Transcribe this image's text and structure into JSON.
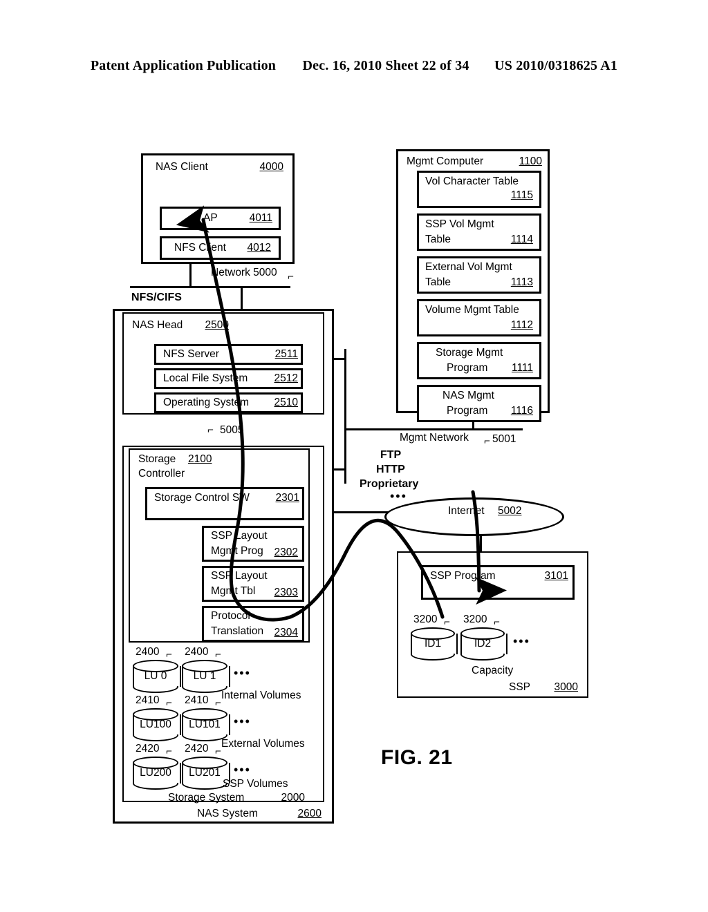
{
  "header": {
    "publication": "Patent Application Publication",
    "date_sheet": "Dec. 16, 2010  Sheet 22 of 34",
    "patent_number": "US 2010/0318625 A1"
  },
  "figure_label": "FIG. 21",
  "diagram": {
    "nas_client": {
      "title": "NAS Client",
      "number": "4000",
      "children": [
        {
          "title": "AP",
          "number": "4011"
        },
        {
          "title": "NFS Client",
          "number": "4012"
        }
      ]
    },
    "mgmt_computer": {
      "title": "Mgmt Computer",
      "number": "1100",
      "children": [
        {
          "line1": "Vol Character Table",
          "line2": "",
          "number": "1115"
        },
        {
          "line1": "SSP Vol Mgmt",
          "line2": "Table",
          "number": "1114"
        },
        {
          "line1": "External Vol Mgmt",
          "line2": "Table",
          "number": "1113"
        },
        {
          "line1": "Volume Mgmt Table",
          "line2": "",
          "number": "1112"
        },
        {
          "line1": "Storage Mgmt",
          "line2": "Program",
          "number": "1111"
        },
        {
          "line1": "NAS Mgmt",
          "line2": "Program",
          "number": "1116"
        }
      ]
    },
    "nas_head": {
      "title": "NAS Head",
      "number": "2500",
      "children": [
        {
          "title": "NFS Server",
          "number": "2511"
        },
        {
          "title": "Local File System",
          "number": "2512"
        },
        {
          "title": "Operating System",
          "number": "2510"
        }
      ]
    },
    "storage_controller": {
      "title_line1": "Storage",
      "title_line2": "Controller",
      "number": "2100",
      "children": [
        {
          "line1": "Storage Control SW",
          "line2": "",
          "number": "2301"
        },
        {
          "line1": "SSP Layout",
          "line2": "Mgmt Prog",
          "number": "2302"
        },
        {
          "line1": "SSP Layout",
          "line2": "Mgmt Tbl",
          "number": "2303"
        },
        {
          "line1": "Protocol",
          "line2": "Translation",
          "number": "2304"
        }
      ]
    },
    "storage_system": {
      "title": "Storage System",
      "number": "2000"
    },
    "nas_system": {
      "title": "NAS System",
      "number": "2600"
    },
    "volumes": {
      "rows": [
        {
          "group_label": "Internal Volumes",
          "ref": "2400",
          "units": [
            "LU 0",
            "LU 1"
          ],
          "ellipsis": "•••"
        },
        {
          "group_label": "External Volumes",
          "ref": "2410",
          "units": [
            "LU100",
            "LU101"
          ],
          "ellipsis": "•••"
        },
        {
          "group_label": "SSP Volumes",
          "ref": "2420",
          "units": [
            "LU200",
            "LU201"
          ],
          "ellipsis": "•••"
        }
      ]
    },
    "ssp": {
      "title": "SSP",
      "number": "3000",
      "program": {
        "title": "SSP Program",
        "number": "3101"
      },
      "capacity_label": "Capacity",
      "disk_ref": "3200",
      "disks": [
        "ID1",
        "ID2"
      ],
      "ellipsis": "•••"
    },
    "networks": {
      "network_5000": {
        "label": "Network 5000",
        "number": "5000"
      },
      "mgmt_network": {
        "label": "Mgmt Network",
        "number": "5001"
      },
      "internet": {
        "label": "Internet",
        "number": "5002"
      },
      "internal_link": {
        "number": "5005"
      }
    },
    "protocol_labels": {
      "nfs_cifs": "NFS/CIFS",
      "stack": [
        "FTP",
        "HTTP",
        "Proprietary"
      ],
      "ellipsis": "•••"
    }
  }
}
